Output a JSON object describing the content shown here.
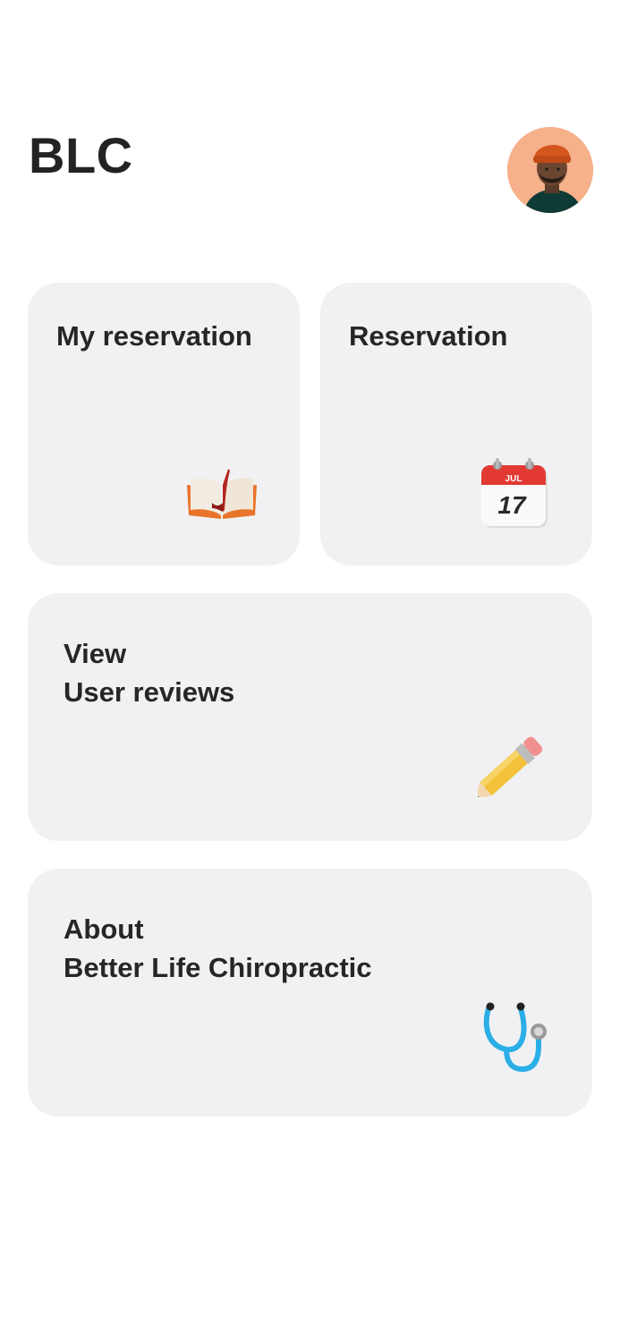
{
  "header": {
    "title": "BLC",
    "avatar_alt": "profile-avatar"
  },
  "cards": {
    "my_reservation": {
      "label": "My reservation",
      "icon": "open-book-icon"
    },
    "reservation": {
      "label": "Reservation",
      "icon": "calendar-icon",
      "calendar_month": "JUL",
      "calendar_day": "17"
    },
    "reviews": {
      "label": "View\nUser reviews",
      "icon": "pencil-icon"
    },
    "about": {
      "label": "About\nBetter Life Chiropractic",
      "icon": "stethoscope-icon"
    }
  },
  "colors": {
    "card_bg": "#f1f1f3",
    "text": "#232323",
    "avatar_bg": "#f6b08a"
  }
}
